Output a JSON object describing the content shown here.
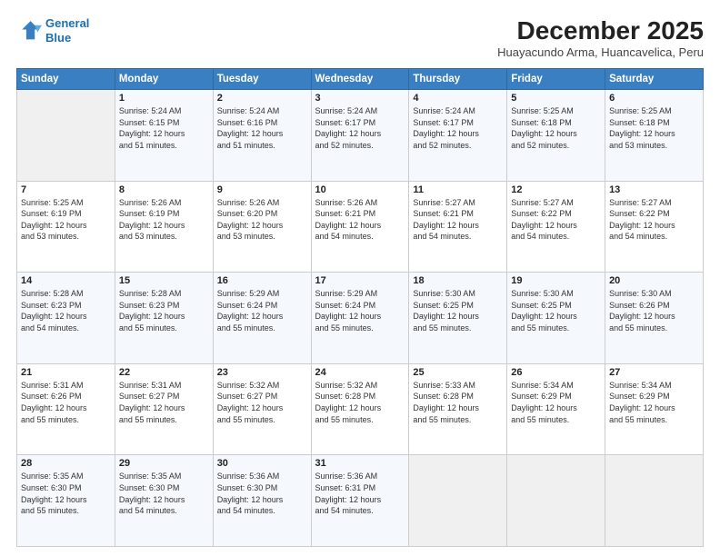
{
  "header": {
    "logo_line1": "General",
    "logo_line2": "Blue",
    "title": "December 2025",
    "subtitle": "Huayacundo Arma, Huancavelica, Peru"
  },
  "days_of_week": [
    "Sunday",
    "Monday",
    "Tuesday",
    "Wednesday",
    "Thursday",
    "Friday",
    "Saturday"
  ],
  "weeks": [
    [
      {
        "day": "",
        "info": ""
      },
      {
        "day": "1",
        "info": "Sunrise: 5:24 AM\nSunset: 6:15 PM\nDaylight: 12 hours\nand 51 minutes."
      },
      {
        "day": "2",
        "info": "Sunrise: 5:24 AM\nSunset: 6:16 PM\nDaylight: 12 hours\nand 51 minutes."
      },
      {
        "day": "3",
        "info": "Sunrise: 5:24 AM\nSunset: 6:17 PM\nDaylight: 12 hours\nand 52 minutes."
      },
      {
        "day": "4",
        "info": "Sunrise: 5:24 AM\nSunset: 6:17 PM\nDaylight: 12 hours\nand 52 minutes."
      },
      {
        "day": "5",
        "info": "Sunrise: 5:25 AM\nSunset: 6:18 PM\nDaylight: 12 hours\nand 52 minutes."
      },
      {
        "day": "6",
        "info": "Sunrise: 5:25 AM\nSunset: 6:18 PM\nDaylight: 12 hours\nand 53 minutes."
      }
    ],
    [
      {
        "day": "7",
        "info": "Sunrise: 5:25 AM\nSunset: 6:19 PM\nDaylight: 12 hours\nand 53 minutes."
      },
      {
        "day": "8",
        "info": "Sunrise: 5:26 AM\nSunset: 6:19 PM\nDaylight: 12 hours\nand 53 minutes."
      },
      {
        "day": "9",
        "info": "Sunrise: 5:26 AM\nSunset: 6:20 PM\nDaylight: 12 hours\nand 53 minutes."
      },
      {
        "day": "10",
        "info": "Sunrise: 5:26 AM\nSunset: 6:21 PM\nDaylight: 12 hours\nand 54 minutes."
      },
      {
        "day": "11",
        "info": "Sunrise: 5:27 AM\nSunset: 6:21 PM\nDaylight: 12 hours\nand 54 minutes."
      },
      {
        "day": "12",
        "info": "Sunrise: 5:27 AM\nSunset: 6:22 PM\nDaylight: 12 hours\nand 54 minutes."
      },
      {
        "day": "13",
        "info": "Sunrise: 5:27 AM\nSunset: 6:22 PM\nDaylight: 12 hours\nand 54 minutes."
      }
    ],
    [
      {
        "day": "14",
        "info": "Sunrise: 5:28 AM\nSunset: 6:23 PM\nDaylight: 12 hours\nand 54 minutes."
      },
      {
        "day": "15",
        "info": "Sunrise: 5:28 AM\nSunset: 6:23 PM\nDaylight: 12 hours\nand 55 minutes."
      },
      {
        "day": "16",
        "info": "Sunrise: 5:29 AM\nSunset: 6:24 PM\nDaylight: 12 hours\nand 55 minutes."
      },
      {
        "day": "17",
        "info": "Sunrise: 5:29 AM\nSunset: 6:24 PM\nDaylight: 12 hours\nand 55 minutes."
      },
      {
        "day": "18",
        "info": "Sunrise: 5:30 AM\nSunset: 6:25 PM\nDaylight: 12 hours\nand 55 minutes."
      },
      {
        "day": "19",
        "info": "Sunrise: 5:30 AM\nSunset: 6:25 PM\nDaylight: 12 hours\nand 55 minutes."
      },
      {
        "day": "20",
        "info": "Sunrise: 5:30 AM\nSunset: 6:26 PM\nDaylight: 12 hours\nand 55 minutes."
      }
    ],
    [
      {
        "day": "21",
        "info": "Sunrise: 5:31 AM\nSunset: 6:26 PM\nDaylight: 12 hours\nand 55 minutes."
      },
      {
        "day": "22",
        "info": "Sunrise: 5:31 AM\nSunset: 6:27 PM\nDaylight: 12 hours\nand 55 minutes."
      },
      {
        "day": "23",
        "info": "Sunrise: 5:32 AM\nSunset: 6:27 PM\nDaylight: 12 hours\nand 55 minutes."
      },
      {
        "day": "24",
        "info": "Sunrise: 5:32 AM\nSunset: 6:28 PM\nDaylight: 12 hours\nand 55 minutes."
      },
      {
        "day": "25",
        "info": "Sunrise: 5:33 AM\nSunset: 6:28 PM\nDaylight: 12 hours\nand 55 minutes."
      },
      {
        "day": "26",
        "info": "Sunrise: 5:34 AM\nSunset: 6:29 PM\nDaylight: 12 hours\nand 55 minutes."
      },
      {
        "day": "27",
        "info": "Sunrise: 5:34 AM\nSunset: 6:29 PM\nDaylight: 12 hours\nand 55 minutes."
      }
    ],
    [
      {
        "day": "28",
        "info": "Sunrise: 5:35 AM\nSunset: 6:30 PM\nDaylight: 12 hours\nand 55 minutes."
      },
      {
        "day": "29",
        "info": "Sunrise: 5:35 AM\nSunset: 6:30 PM\nDaylight: 12 hours\nand 54 minutes."
      },
      {
        "day": "30",
        "info": "Sunrise: 5:36 AM\nSunset: 6:30 PM\nDaylight: 12 hours\nand 54 minutes."
      },
      {
        "day": "31",
        "info": "Sunrise: 5:36 AM\nSunset: 6:31 PM\nDaylight: 12 hours\nand 54 minutes."
      },
      {
        "day": "",
        "info": ""
      },
      {
        "day": "",
        "info": ""
      },
      {
        "day": "",
        "info": ""
      }
    ]
  ]
}
